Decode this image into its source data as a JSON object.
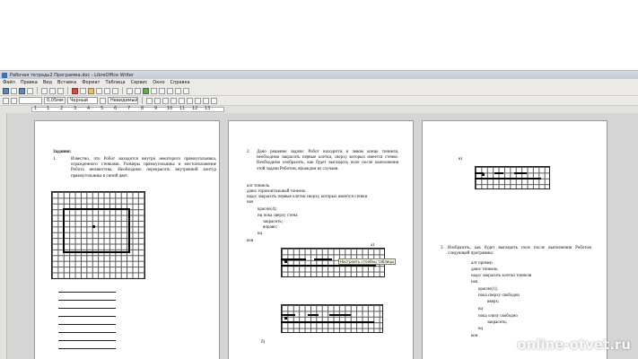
{
  "window": {
    "title": "Рабочая тетрадь2 Программа.doc - LibreOffice Writer"
  },
  "menu": [
    "Файл",
    "Правка",
    "Вид",
    "Вставка",
    "Формат",
    "Таблица",
    "Сервис",
    "Окно",
    "Справка"
  ],
  "format_bar": {
    "style": "",
    "font_size": "0,05мм",
    "color": "Черный",
    "highlight": "Невидимый"
  },
  "ruler": {
    "ticks": [
      "1",
      "1",
      "2",
      "3",
      "4",
      "5",
      "6",
      "7",
      "8",
      "9",
      "10",
      "11",
      "12",
      "13"
    ]
  },
  "page1": {
    "heading": "Задания:",
    "item_number": "1.",
    "task1": "Известно, что Робот находится внутри некоторого прямоугольника, огражденного стенками. Размеры прямоугольника и местоположение Робота неизвестны. Необходимо перекрасить внутренний контур прямоугольника в синий цвет."
  },
  "page2": {
    "item_number": "2.",
    "task2": "Дано решение задачи: Робот находится в левом конце тоннеля, необходимо закрасить первые клетки, сверху которых имеется стенке. Необходимо изобразить, как будет выглядеть поле после выполнения этой задачи Роботом, в(каждом из случаев.",
    "code": [
      "алг тоннель",
      "дано/ горизонтальный тоннель",
      "надо/ закрасить первые клетки сверху, которых имеется стенки",
      "нач",
      "красно(4);",
      "нц пока сверху стена",
      "закрасить;",
      "вправо;",
      "кц",
      "кон"
    ],
    "label_a": "а)",
    "label_b": "б)",
    "tooltip": "Настроить столбец таблицы"
  },
  "page3": {
    "label_v": "в)",
    "item_number": "3.",
    "task3": "Изобразить, как будет выглядеть поле после выполнения Роботом следующей программы:",
    "code": [
      "алг пример",
      "дано/ тоннель",
      "надо/ закрасить клетки тоннеля",
      "нач",
      "красно(1);",
      "пока сверху свободно",
      "вверх;",
      "кц",
      "пока снизу свободно",
      "закрасить;",
      "кц",
      "кон"
    ]
  },
  "watermark": "online-otvet.ru"
}
